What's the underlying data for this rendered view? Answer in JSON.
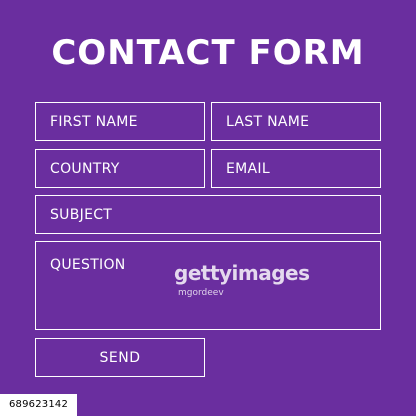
{
  "form": {
    "title": "CONTACT FORM",
    "fields": {
      "first_name": "FIRST NAME",
      "last_name": "LAST NAME",
      "country": "COUNTRY",
      "email": "EMAIL",
      "subject": "SUBJECT",
      "question": "QUESTION"
    },
    "send_label": "SEND"
  },
  "watermark": {
    "brand": "gettyimages",
    "credit": "mgordeev"
  },
  "stock_id": "689623142",
  "colors": {
    "background": "#6a2e9f",
    "foreground": "#ffffff"
  }
}
